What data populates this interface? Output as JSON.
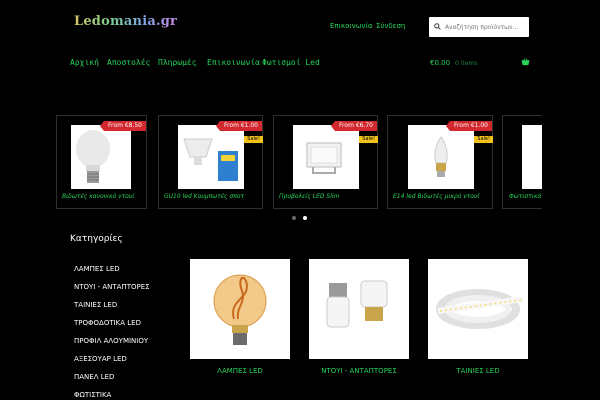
{
  "header": {
    "logo": "Ledomania.gr",
    "links": [
      "Επικοινωνία",
      "Σύνδεση"
    ],
    "search_placeholder": "Αναζήτηση προϊόντων..."
  },
  "nav": {
    "items": [
      "Αρχική",
      "Αποστολές",
      "Πληρωμές",
      "Επικοινωνία",
      "Φωτισμοί Led"
    ],
    "cart_total": "€0.00",
    "cart_count": "0 items"
  },
  "carousel": {
    "products": [
      {
        "title": "Βιδωτές κανονικό ντουί",
        "price": "From €8.50",
        "tag": ""
      },
      {
        "title": "GU10 led Κουμπωτές σποτ",
        "price": "From €1.00",
        "tag": "Sale!"
      },
      {
        "title": "Προβολείς LED Slim",
        "price": "From €6.70",
        "tag": "Sale!"
      },
      {
        "title": "E14 led Βιδωτές μικρό ντουί",
        "price": "From €1.00",
        "tag": "Sale!"
      },
      {
        "title": "Φωτιστικά",
        "price": "",
        "tag": ""
      }
    ],
    "active_dot": 2
  },
  "categories": {
    "heading": "Κατηγορίες",
    "items": [
      "ΛΑΜΠΕΣ LED",
      "ΝΤΟΥΙ - ΑΝΤΑΠΤΟΡΕΣ",
      "ΤΑΙΝΙΕΣ LED",
      "ΤΡΟΦΟΔΟΤΙΚΑ LED",
      "ΠΡΟΦΙΛ ΑΛΟΥΜΙΝΙΟΥ",
      "ΑΞΕΣΟΥΑΡ LED",
      "ΠΑΝΕΛ LED",
      "ΦΩΤΙΣΤΙΚΑ"
    ]
  },
  "tiles": [
    "ΛΑΜΠΕΣ LED",
    "ΝΤΟΥΙ - ΑΝΤΑΠΤΟΡΕΣ",
    "ΤΑΙΝΙΕΣ LED"
  ],
  "colors": {
    "accent": "#27d35a",
    "sale": "#d2292e",
    "badge": "#f2c21b",
    "background": "#000000"
  }
}
